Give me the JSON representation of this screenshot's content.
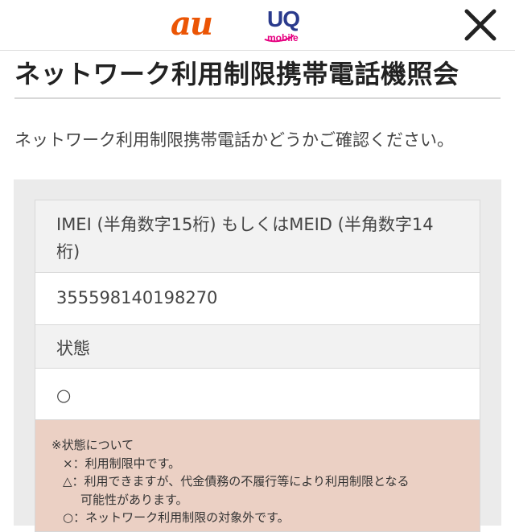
{
  "header": {
    "logo_au": "au",
    "logo_uq": "UQ",
    "logo_uq_sub": "mobile",
    "close_icon": "close-icon"
  },
  "colors": {
    "au_orange": "#eb5505",
    "uq_navy": "#2a3a8c",
    "uq_pink": "#e60080",
    "notes_bg": "#ebd0c4"
  },
  "page": {
    "title": "ネットワーク利用制限携帯電話機照会",
    "intro": "ネットワーク利用制限携帯電話かどうかご確認ください。"
  },
  "result_table": {
    "imei_label_line1": "IMEI (半角数字15桁) もしくはMEID (半角数字14",
    "imei_label_line2": "桁)",
    "imei_value": "355598140198270",
    "status_label": "状態",
    "status_value": "○"
  },
  "notes": {
    "heading": "※状態について",
    "x_line": "×：利用制限中です。",
    "triangle_line1": "△：利用できますが、代金債務の不履行等により利用制限となる",
    "triangle_line2": "可能性があります。",
    "circle_line": "○：ネットワーク利用制限の対象外です。"
  }
}
